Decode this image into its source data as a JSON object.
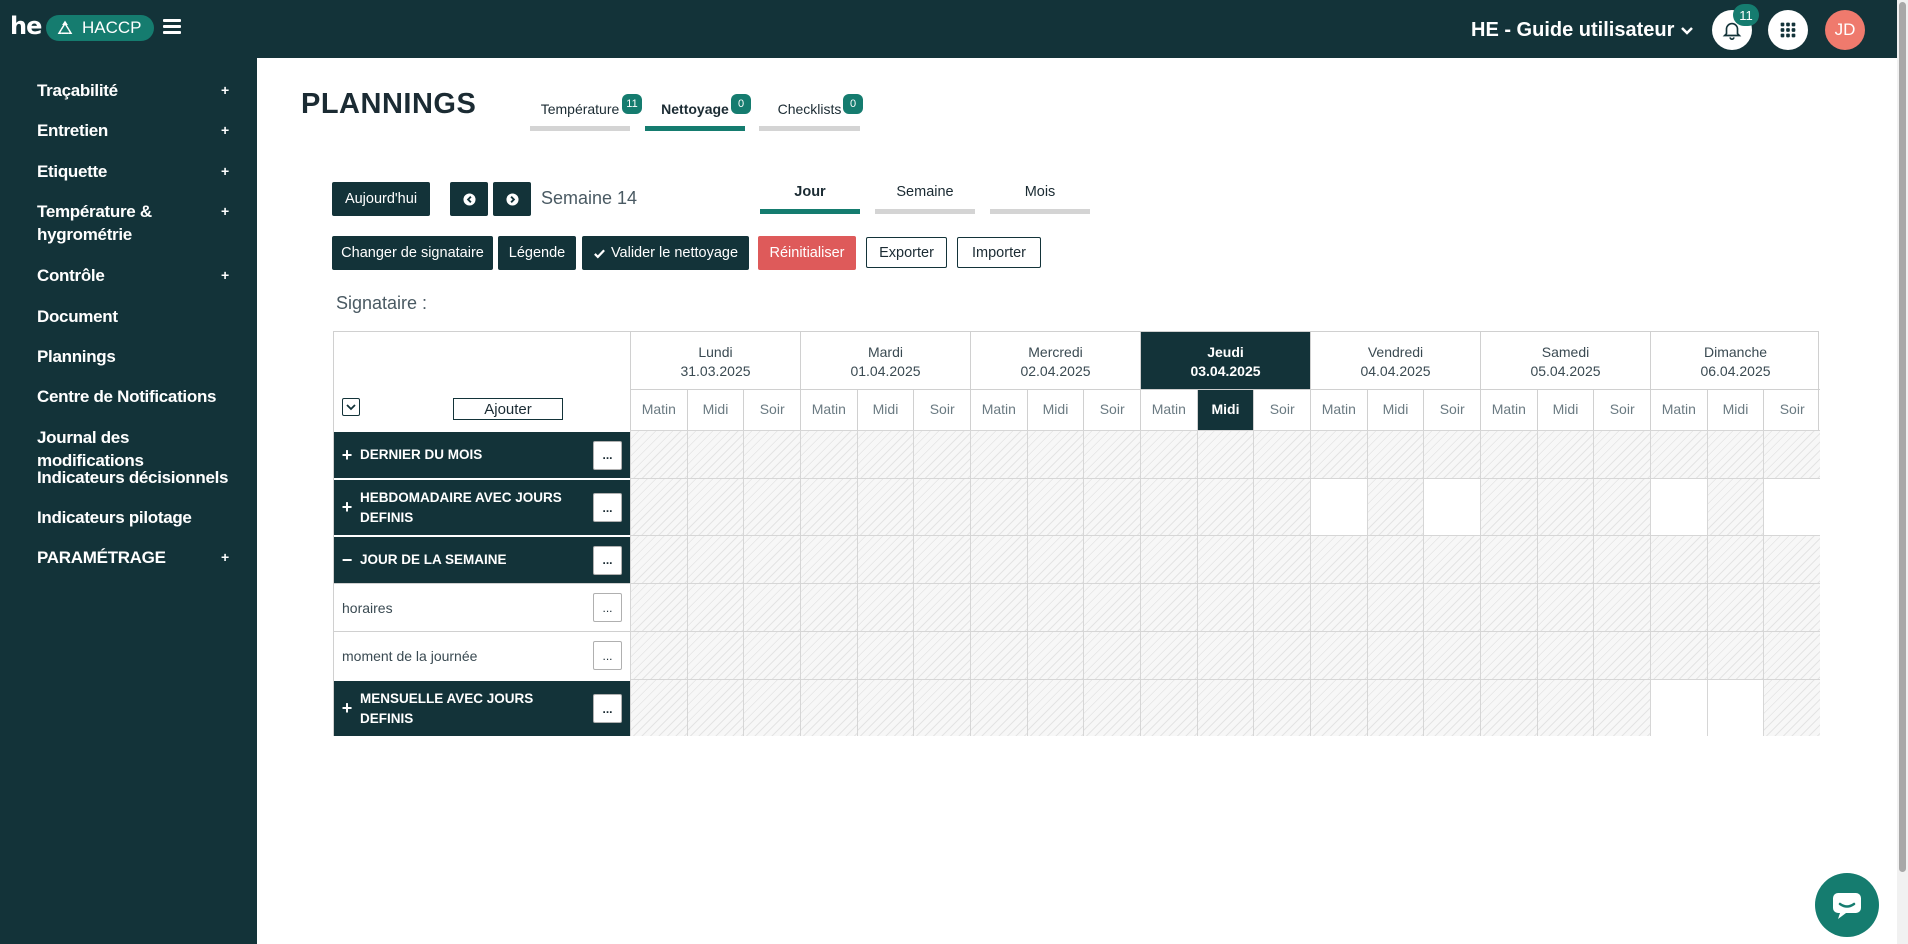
{
  "header": {
    "logo_text": "he",
    "app_name": "HACCP",
    "site_title": "HE - Guide utilisateur",
    "notification_count": "11",
    "avatar_initials": "JD"
  },
  "sidebar": {
    "items": [
      {
        "label": "Traçabilité",
        "expandable": "+"
      },
      {
        "label": "Entretien",
        "expandable": "+"
      },
      {
        "label": "Etiquette",
        "expandable": "+"
      },
      {
        "label": "Température & hygrométrie",
        "expandable": "+"
      },
      {
        "label": "Contrôle",
        "expandable": "+"
      },
      {
        "label": "Document"
      },
      {
        "label": "Plannings"
      },
      {
        "label": "Centre de Notifications"
      },
      {
        "label": "Journal des modifications"
      },
      {
        "label": "Indicateurs décisionnels"
      },
      {
        "label": "Indicateurs pilotage"
      },
      {
        "label": "PARAMÉTRAGE",
        "expandable": "+"
      }
    ]
  },
  "page": {
    "title": "PLANNINGS",
    "tabs": [
      {
        "label": "Température",
        "badge": "11"
      },
      {
        "label": "Nettoyage",
        "badge": "0",
        "active": true
      },
      {
        "label": "Checklists",
        "badge": "0"
      }
    ]
  },
  "toolbar": {
    "today": "Aujourd'hui",
    "week_label": "Semaine 14",
    "views": [
      "Jour",
      "Semaine",
      "Mois"
    ],
    "change_signatory": "Changer de signataire",
    "legend": "Légende",
    "validate": "Valider le nettoyage",
    "reset": "Réinitialiser",
    "export": "Exporter",
    "import": "Importer",
    "signatory_label": "Signataire :"
  },
  "grid": {
    "add_label": "Ajouter",
    "days": [
      {
        "name": "Lundi",
        "date": "31.03.2025"
      },
      {
        "name": "Mardi",
        "date": "01.04.2025"
      },
      {
        "name": "Mercredi",
        "date": "02.04.2025"
      },
      {
        "name": "Jeudi",
        "date": "03.04.2025",
        "today": true
      },
      {
        "name": "Vendredi",
        "date": "04.04.2025"
      },
      {
        "name": "Samedi",
        "date": "05.04.2025"
      },
      {
        "name": "Dimanche",
        "date": "06.04.2025"
      }
    ],
    "slots": [
      "Matin",
      "Midi",
      "Soir"
    ],
    "active_slot": "Jeudi-Midi",
    "more_label": "...",
    "rows": [
      {
        "label": "DERNIER DU MOIS",
        "type": "group",
        "sign": "+"
      },
      {
        "label": "HEBDOMADAIRE AVEC JOURS DEFINIS",
        "type": "group",
        "sign": "+"
      },
      {
        "label": "JOUR DE LA SEMAINE",
        "type": "group",
        "sign": "−"
      },
      {
        "label": "horaires",
        "type": "sub"
      },
      {
        "label": "moment de la journée",
        "type": "sub"
      },
      {
        "label": "MENSUELLE AVEC JOURS DEFINIS",
        "type": "group",
        "sign": "+"
      }
    ]
  },
  "colors": {
    "primary": "#133339",
    "accent": "#157c6f",
    "danger": "#de5a5a",
    "avatar": "#ef7a6d"
  }
}
